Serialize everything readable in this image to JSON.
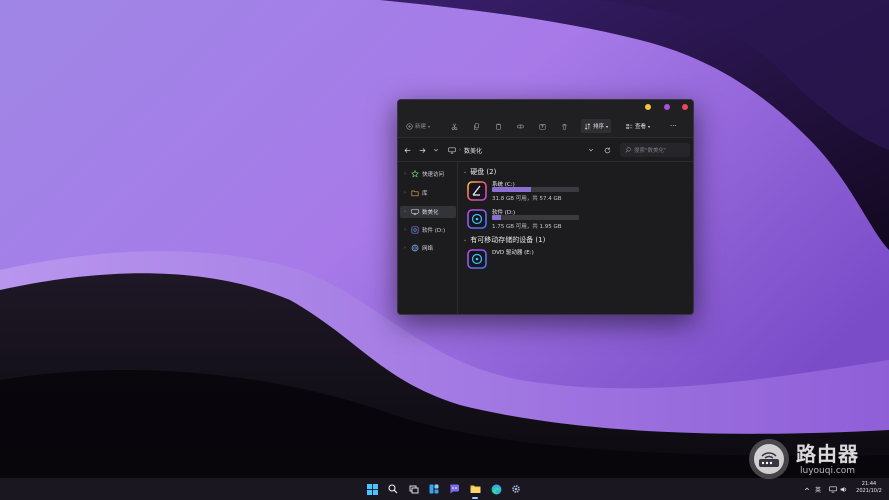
{
  "window": {
    "controls": {
      "minimize_color": "#f5c33b",
      "maximize_color": "#a94ce0",
      "close_color": "#f0455a"
    },
    "toolbar": {
      "new_label": "新建",
      "sort_label": "排序",
      "view_label": "查看",
      "more_label": "···"
    },
    "address": {
      "breadcrumb": "数美化",
      "search_placeholder": "搜索\"数美化\""
    },
    "sidebar": {
      "items": [
        {
          "label": "快速访问",
          "icon": "star-icon"
        },
        {
          "label": "库",
          "icon": "folder-icon"
        },
        {
          "label": "数美化",
          "icon": "computer-icon"
        },
        {
          "label": "软件 (D:)",
          "icon": "drive-icon"
        },
        {
          "label": "网络",
          "icon": "network-icon"
        }
      ],
      "selected_index": 2
    },
    "content": {
      "groups": [
        {
          "title": "硬盘 (2)"
        },
        {
          "title": "有可移动存储的设备 (1)"
        }
      ],
      "drives": [
        {
          "name": "系统 (C:)",
          "info": "31.8 GB 可用，共 57.4 GB",
          "used_fraction": 0.45,
          "icon": "system-drive-icon"
        },
        {
          "name": "软件 (D:)",
          "info": "1.75 GB 可用，共 1.95 GB",
          "used_fraction": 0.1,
          "icon": "software-drive-icon"
        },
        {
          "name": "DVD 驱动器 (E:)",
          "info": "",
          "icon": "dvd-drive-icon"
        }
      ]
    }
  },
  "taskbar": {
    "tray_language": "英",
    "clock_time": "21:44",
    "clock_date": "2021/10/2"
  },
  "watermark": {
    "title": "路由器",
    "url": "luyouqi.com"
  },
  "colors": {
    "accent": "#8a6fd0",
    "window_bg": "#1c1c1e"
  }
}
